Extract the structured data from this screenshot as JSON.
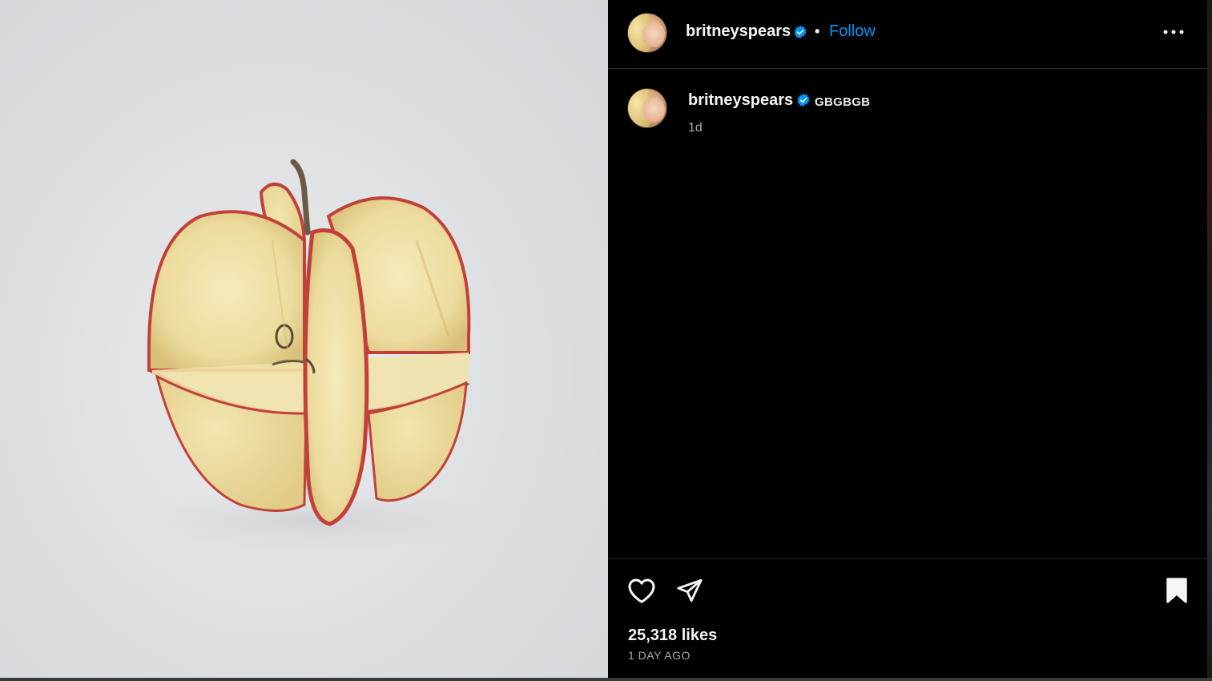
{
  "post": {
    "image_subject": "sliced-apple-photo"
  },
  "header": {
    "username": "britneyspears",
    "separator": "•",
    "follow_label": "Follow",
    "more_icon": "more-options-icon"
  },
  "caption": {
    "username": "britneyspears",
    "text": "GBGBGB",
    "time": "1d"
  },
  "actions": {
    "like_icon": "heart-icon",
    "share_icon": "send-icon",
    "save_icon": "bookmark-icon",
    "likes": "25,318 likes",
    "posted": "1 DAY AGO"
  },
  "colors": {
    "follow": "#0095f6",
    "verified": "#0095f6",
    "background": "#000000"
  }
}
